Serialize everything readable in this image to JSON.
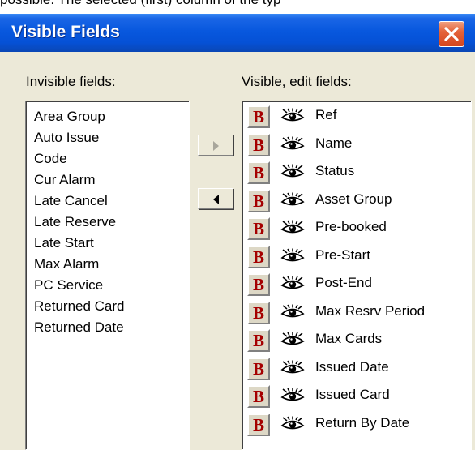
{
  "window": {
    "title": "Visible Fields",
    "top_partial_text": "possible. The selected (first) column of the typ"
  },
  "labels": {
    "invisible": "Invisible fields:",
    "visible": "Visible, edit fields:"
  },
  "invisible_fields": [
    "Area Group",
    "Auto Issue",
    "Code",
    "Cur Alarm",
    "Late Cancel",
    "Late Reserve",
    "Late Start",
    "Max Alarm",
    "PC Service",
    "Returned Card",
    "Returned Date"
  ],
  "visible_fields": [
    "Ref",
    "Name",
    "Status",
    "Asset Group",
    "Pre-booked",
    "Pre-Start",
    "Post-End",
    "Max Resrv Period",
    "Max Cards",
    "Issued Date",
    "Issued Card",
    "Return By Date"
  ],
  "bold_button_label": "B",
  "icons": {
    "bold": "bold-toggle-icon",
    "visibility": "eye-icon",
    "move_right": "arrow-right-icon",
    "move_left": "arrow-left-icon",
    "close": "close-icon"
  },
  "colors": {
    "titlebar": "#0858de",
    "bold_letter": "#a50000",
    "close_button": "#e4633a",
    "dialog_background": "#ece9d8"
  }
}
